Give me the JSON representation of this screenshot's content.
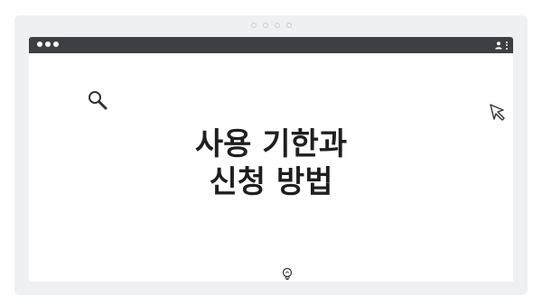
{
  "slide": {
    "title_line1": "사용 기한과",
    "title_line2": "신청 방법"
  },
  "icons": {
    "search": "search-icon",
    "cursor": "cursor-icon",
    "bulb": "lightbulb-icon",
    "user": "user-icon",
    "menu": "kebab-menu-icon"
  },
  "colors": {
    "frame_bg": "#eef0f3",
    "titlebar": "#3c3f43",
    "text": "#1f1f1f"
  }
}
